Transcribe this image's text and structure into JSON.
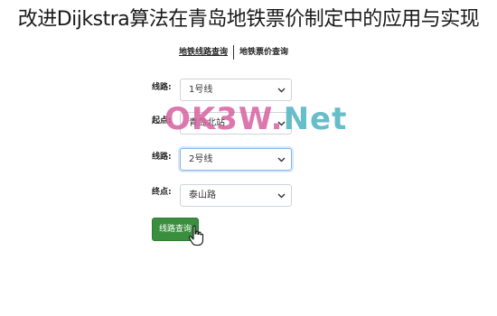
{
  "title": "改进Dijkstra算法在青岛地铁票价制定中的应用与实现",
  "tabs": [
    {
      "label": "地铁线路查询",
      "active": true
    },
    {
      "label": "地铁票价查询",
      "active": false
    }
  ],
  "form": {
    "line1_label": "线路:",
    "line1_value": "1号线",
    "start_label": "起点:",
    "start_value": "青岛北站",
    "line2_label": "线路:",
    "line2_value": "2号线",
    "end_label": "终点:",
    "end_value": "泰山路",
    "query_button": "线路查询"
  },
  "watermark": {
    "part1": "OK3W.",
    "part2": "Net"
  },
  "colors": {
    "button": "#3a8f3f",
    "watermark_pink": "#d660a0",
    "watermark_teal": "#56b6c4",
    "focus_border": "#86b7e8"
  }
}
